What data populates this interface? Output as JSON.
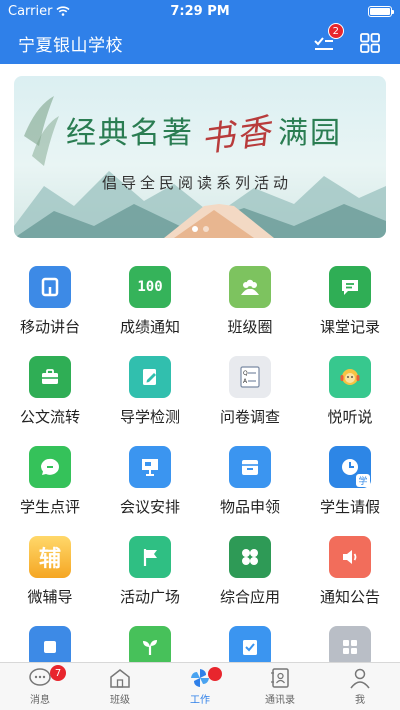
{
  "status_bar": {
    "carrier": "Carrier",
    "time": "7:29 PM"
  },
  "header": {
    "title": "宁夏银山学校",
    "task_badge": "2"
  },
  "banner": {
    "headline": "经典名著",
    "headline_brush": "书香",
    "headline_end": "满园",
    "subtitle": "倡导全民阅读系列活动"
  },
  "apps": [
    [
      {
        "label": "移动讲台",
        "color": "#3d8ae6",
        "icon": "slides-icon"
      },
      {
        "label": "成绩通知",
        "color": "#35b35a",
        "icon": "score-icon",
        "glyph": "100"
      },
      {
        "label": "班级圈",
        "color": "#7dc35f",
        "icon": "group-icon"
      },
      {
        "label": "课堂记录",
        "color": "#2fae55",
        "icon": "chat-record-icon"
      }
    ],
    [
      {
        "label": "公文流转",
        "color": "#2fae55",
        "icon": "briefcase-icon"
      },
      {
        "label": "导学检测",
        "color": "#31bfae",
        "icon": "edit-doc-icon"
      },
      {
        "label": "问卷调查",
        "color": "#e8eaee",
        "icon": "questionnaire-icon",
        "glyph": "Q= A="
      },
      {
        "label": "悦听说",
        "color": "#37c88e",
        "icon": "listen-avatar-icon"
      }
    ],
    [
      {
        "label": "学生点评",
        "color": "#35c25a",
        "icon": "comment-icon"
      },
      {
        "label": "会议安排",
        "color": "#3b95f0",
        "icon": "presentation-icon"
      },
      {
        "label": "物品申领",
        "color": "#3b95f0",
        "icon": "goods-icon"
      },
      {
        "label": "学生请假",
        "color": "#2d86e6",
        "icon": "clock-leave-icon",
        "glyph": "学"
      }
    ],
    [
      {
        "label": "微辅导",
        "color": "#f5a623",
        "icon": "tutor-icon",
        "glyph": "辅"
      },
      {
        "label": "活动广场",
        "color": "#2fbf83",
        "icon": "flag-icon"
      },
      {
        "label": "综合应用",
        "color": "#2e9a56",
        "icon": "apps-icon"
      },
      {
        "label": "通知公告",
        "color": "#f26d5b",
        "icon": "speaker-icon"
      }
    ],
    [
      {
        "label": "",
        "color": "#3d8ae6",
        "icon": "more-app-icon-1"
      },
      {
        "label": "",
        "color": "#47c15a",
        "icon": "sprout-icon"
      },
      {
        "label": "",
        "color": "#3b95f0",
        "icon": "checklist-icon"
      },
      {
        "label": "",
        "color": "#b9bec6",
        "icon": "grid-app-icon"
      }
    ]
  ],
  "tabs": [
    {
      "label": "消息",
      "badge": "7"
    },
    {
      "label": "班级"
    },
    {
      "label": "工作"
    },
    {
      "label": "通讯录"
    },
    {
      "label": "我"
    }
  ]
}
